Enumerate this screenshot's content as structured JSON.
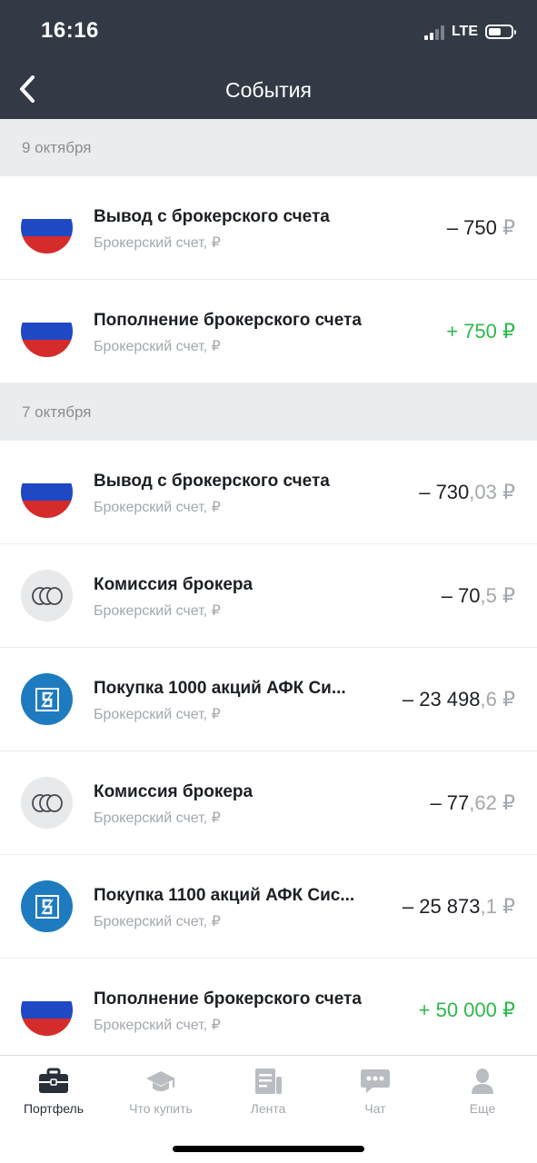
{
  "status_bar": {
    "time": "16:16",
    "network": "LTE"
  },
  "header": {
    "title": "События",
    "back_icon": "chevron-left-icon"
  },
  "sections": [
    {
      "date": "9 октября",
      "items": [
        {
          "icon": "russia-flag-icon",
          "title": "Вывод с брокерского счета",
          "subtitle": "Брокерский счет, ₽",
          "amount_int": "– 750",
          "amount_frac": "",
          "currency": "₽",
          "positive": false
        },
        {
          "icon": "russia-flag-icon",
          "title": "Пополнение брокерского счета",
          "subtitle": "Брокерский счет, ₽",
          "amount_int": "+ 750",
          "amount_frac": "",
          "currency": "₽",
          "positive": true
        }
      ]
    },
    {
      "date": "7 октября",
      "items": [
        {
          "icon": "russia-flag-icon",
          "title": "Вывод с брокерского счета",
          "subtitle": "Брокерский счет, ₽",
          "amount_int": "– 730",
          "amount_frac": ",03",
          "currency": "₽",
          "positive": false
        },
        {
          "icon": "coins-icon",
          "title": "Комиссия брокера",
          "subtitle": "Брокерский счет, ₽",
          "amount_int": "– 70",
          "amount_frac": ",5",
          "currency": "₽",
          "positive": false
        },
        {
          "icon": "afk-sistema-logo-icon",
          "title": "Покупка 1000 акций АФК Си...",
          "subtitle": "Брокерский счет, ₽",
          "amount_int": "– 23 498",
          "amount_frac": ",6",
          "currency": "₽",
          "positive": false
        },
        {
          "icon": "coins-icon",
          "title": "Комиссия брокера",
          "subtitle": "Брокерский счет, ₽",
          "amount_int": "– 77",
          "amount_frac": ",62",
          "currency": "₽",
          "positive": false
        },
        {
          "icon": "afk-sistema-logo-icon",
          "title": "Покупка 1100 акций АФК Сис...",
          "subtitle": "Брокерский счет, ₽",
          "amount_int": "– 25 873",
          "amount_frac": ",1",
          "currency": "₽",
          "positive": false
        },
        {
          "icon": "russia-flag-icon",
          "title": "Пополнение брокерского счета",
          "subtitle": "Брокерский счет, ₽",
          "amount_int": "+ 50 000",
          "amount_frac": "",
          "currency": "₽",
          "positive": true
        }
      ]
    }
  ],
  "tabs": [
    {
      "label": "Портфель",
      "icon": "briefcase-icon",
      "active": true
    },
    {
      "label": "Что купить",
      "icon": "graduation-cap-icon",
      "active": false
    },
    {
      "label": "Лента",
      "icon": "news-icon",
      "active": false
    },
    {
      "label": "Чат",
      "icon": "chat-icon",
      "active": false
    },
    {
      "label": "Еще",
      "icon": "profile-icon",
      "active": false
    }
  ],
  "colors": {
    "header_bg": "#333a46",
    "positive": "#2db84c",
    "muted": "#a3a7ad",
    "section_bg": "#ebeced",
    "afk_blue": "#1e7bbf"
  }
}
